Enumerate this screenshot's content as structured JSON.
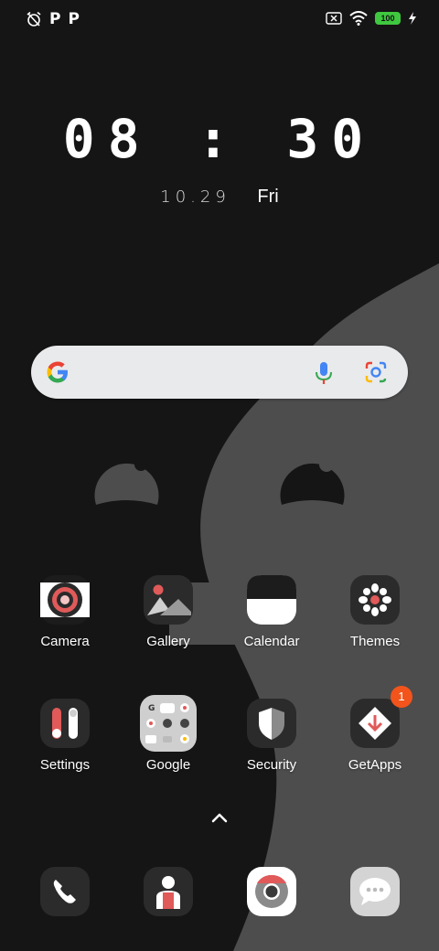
{
  "status_bar": {
    "left_icons": [
      "alarm-off-icon",
      "p-icon",
      "p-icon"
    ],
    "p_label_1": "P",
    "p_label_2": "P",
    "battery_level": "100",
    "right_icons": [
      "no-sim-icon",
      "wifi-icon",
      "battery-icon",
      "charging-icon"
    ],
    "battery_color": "#3fc83f"
  },
  "lockscreen": {
    "time": "08 : 30",
    "date": "10.29",
    "day": "Fri"
  },
  "search_bar": {
    "icons": [
      "google-logo-icon",
      "microphone-icon",
      "google-lens-icon"
    ]
  },
  "apps": [
    {
      "label": "Camera",
      "icon": "camera-icon"
    },
    {
      "label": "Gallery",
      "icon": "gallery-icon"
    },
    {
      "label": "Calendar",
      "icon": "calendar-icon"
    },
    {
      "label": "Themes",
      "icon": "themes-icon"
    },
    {
      "label": "Settings",
      "icon": "settings-icon"
    },
    {
      "label": "Google",
      "icon": "google-folder-icon"
    },
    {
      "label": "Security",
      "icon": "security-shield-icon"
    },
    {
      "label": "GetApps",
      "icon": "getapps-icon",
      "badge": "1"
    }
  ],
  "dock": [
    {
      "icon": "phone-icon"
    },
    {
      "icon": "contacts-icon"
    },
    {
      "icon": "chrome-icon"
    },
    {
      "icon": "messages-icon"
    }
  ],
  "colors": {
    "background_dark": "#151515",
    "wallpaper_gray": "#4d4d4d",
    "accent_red": "#e05a5a",
    "badge_orange": "#f2541b"
  }
}
